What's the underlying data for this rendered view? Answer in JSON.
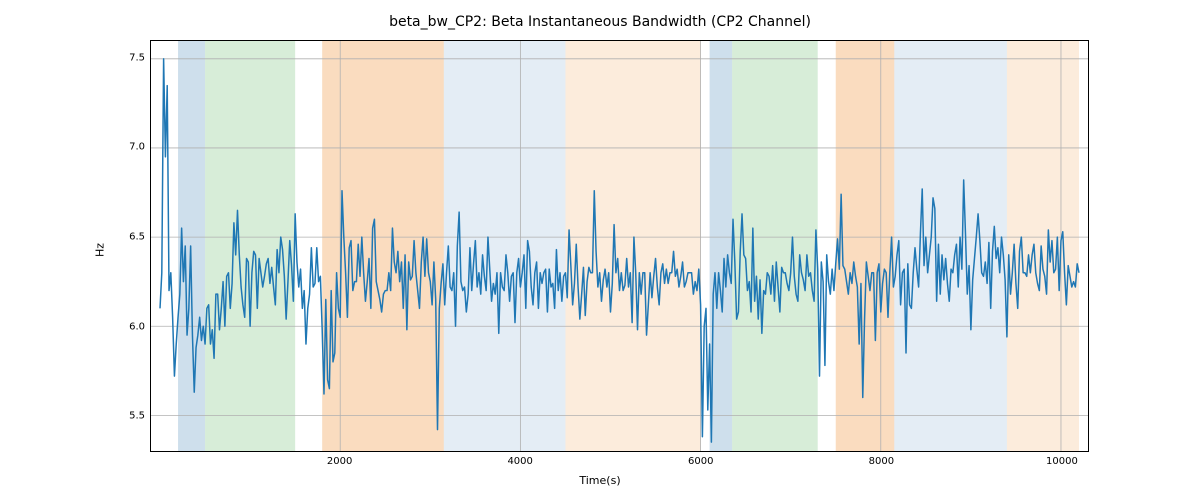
{
  "chart_data": {
    "type": "line",
    "title": "beta_bw_CP2: Beta Instantaneous Bandwidth (CP2 Channel)",
    "xlabel": "Time(s)",
    "ylabel": "Hz",
    "xlim": [
      -100,
      10300
    ],
    "ylim": [
      5.3,
      7.6
    ],
    "xticks": [
      2000,
      4000,
      6000,
      8000,
      10000
    ],
    "yticks": [
      5.5,
      6.0,
      6.5,
      7.0,
      7.5
    ],
    "regions": [
      {
        "x0": 200,
        "x1": 500,
        "color": "#a6c4dd",
        "alpha": 0.55
      },
      {
        "x0": 500,
        "x1": 1500,
        "color": "#b7dfb8",
        "alpha": 0.55
      },
      {
        "x0": 1800,
        "x1": 3150,
        "color": "#f6c08b",
        "alpha": 0.55
      },
      {
        "x0": 3150,
        "x1": 4500,
        "color": "#a6c4dd",
        "alpha": 0.3
      },
      {
        "x0": 4500,
        "x1": 6000,
        "color": "#f6c08b",
        "alpha": 0.3
      },
      {
        "x0": 6100,
        "x1": 6350,
        "color": "#a6c4dd",
        "alpha": 0.55
      },
      {
        "x0": 6350,
        "x1": 7300,
        "color": "#b7dfb8",
        "alpha": 0.55
      },
      {
        "x0": 7500,
        "x1": 8150,
        "color": "#f6c08b",
        "alpha": 0.55
      },
      {
        "x0": 8150,
        "x1": 9400,
        "color": "#a6c4dd",
        "alpha": 0.3
      },
      {
        "x0": 9400,
        "x1": 10200,
        "color": "#f6c08b",
        "alpha": 0.3
      }
    ],
    "line_color": "#1f77b4",
    "series": {
      "x": [
        0,
        20,
        40,
        60,
        80,
        100,
        120,
        140,
        160,
        180,
        200,
        220,
        240,
        260,
        280,
        300,
        320,
        340,
        360,
        380,
        400,
        420,
        440,
        460,
        480,
        500,
        520,
        540,
        560,
        580,
        600,
        620,
        640,
        660,
        680,
        700,
        720,
        740,
        760,
        780,
        800,
        820,
        840,
        860,
        880,
        900,
        920,
        940,
        960,
        980,
        1000,
        1020,
        1040,
        1060,
        1080,
        1100,
        1120,
        1140,
        1160,
        1180,
        1200,
        1220,
        1240,
        1260,
        1280,
        1300,
        1320,
        1340,
        1360,
        1380,
        1400,
        1420,
        1440,
        1460,
        1480,
        1500,
        1520,
        1540,
        1560,
        1580,
        1600,
        1620,
        1640,
        1660,
        1680,
        1700,
        1720,
        1740,
        1760,
        1780,
        1800,
        1820,
        1840,
        1860,
        1880,
        1900,
        1920,
        1940,
        1960,
        1980,
        2000,
        2020,
        2040,
        2060,
        2080,
        2100,
        2120,
        2140,
        2160,
        2180,
        2200,
        2220,
        2240,
        2260,
        2280,
        2300,
        2320,
        2340,
        2360,
        2380,
        2400,
        2420,
        2440,
        2460,
        2480,
        2500,
        2520,
        2540,
        2560,
        2580,
        2600,
        2620,
        2640,
        2660,
        2680,
        2700,
        2720,
        2740,
        2760,
        2780,
        2800,
        2820,
        2840,
        2860,
        2880,
        2900,
        2920,
        2940,
        2960,
        2980,
        3000,
        3020,
        3040,
        3060,
        3080,
        3100,
        3120,
        3140,
        3160,
        3180,
        3200,
        3220,
        3240,
        3260,
        3280,
        3300,
        3320,
        3340,
        3360,
        3380,
        3400,
        3420,
        3440,
        3460,
        3480,
        3500,
        3520,
        3540,
        3560,
        3580,
        3600,
        3620,
        3640,
        3660,
        3680,
        3700,
        3720,
        3740,
        3760,
        3780,
        3800,
        3820,
        3840,
        3860,
        3880,
        3900,
        3920,
        3940,
        3960,
        3980,
        4000,
        4020,
        4040,
        4060,
        4080,
        4100,
        4120,
        4140,
        4160,
        4180,
        4200,
        4220,
        4240,
        4260,
        4280,
        4300,
        4320,
        4340,
        4360,
        4380,
        4400,
        4420,
        4440,
        4460,
        4480,
        4500,
        4520,
        4540,
        4560,
        4580,
        4600,
        4620,
        4640,
        4660,
        4680,
        4700,
        4720,
        4740,
        4760,
        4780,
        4800,
        4820,
        4840,
        4860,
        4880,
        4900,
        4920,
        4940,
        4960,
        4980,
        5000,
        5020,
        5040,
        5060,
        5080,
        5100,
        5120,
        5140,
        5160,
        5180,
        5200,
        5220,
        5240,
        5260,
        5280,
        5300,
        5320,
        5340,
        5360,
        5380,
        5400,
        5420,
        5440,
        5460,
        5480,
        5500,
        5520,
        5540,
        5560,
        5580,
        5600,
        5620,
        5640,
        5660,
        5680,
        5700,
        5720,
        5740,
        5760,
        5780,
        5800,
        5820,
        5840,
        5860,
        5880,
        5900,
        5920,
        5940,
        5960,
        5980,
        6000,
        6020,
        6040,
        6060,
        6080,
        6100,
        6120,
        6140,
        6160,
        6180,
        6200,
        6220,
        6240,
        6260,
        6280,
        6300,
        6320,
        6340,
        6360,
        6380,
        6400,
        6420,
        6440,
        6460,
        6480,
        6500,
        6520,
        6540,
        6560,
        6580,
        6600,
        6620,
        6640,
        6660,
        6680,
        6700,
        6720,
        6740,
        6760,
        6780,
        6800,
        6820,
        6840,
        6860,
        6880,
        6900,
        6920,
        6940,
        6960,
        6980,
        7000,
        7020,
        7040,
        7060,
        7080,
        7100,
        7120,
        7140,
        7160,
        7180,
        7200,
        7220,
        7240,
        7260,
        7280,
        7300,
        7320,
        7340,
        7360,
        7380,
        7400,
        7420,
        7440,
        7460,
        7480,
        7500,
        7520,
        7540,
        7560,
        7580,
        7600,
        7620,
        7640,
        7660,
        7680,
        7700,
        7720,
        7740,
        7760,
        7780,
        7800,
        7820,
        7840,
        7860,
        7880,
        7900,
        7920,
        7940,
        7960,
        7980,
        8000,
        8020,
        8040,
        8060,
        8080,
        8100,
        8120,
        8140,
        8160,
        8180,
        8200,
        8220,
        8240,
        8260,
        8280,
        8300,
        8320,
        8340,
        8360,
        8380,
        8400,
        8420,
        8440,
        8460,
        8480,
        8500,
        8520,
        8540,
        8560,
        8580,
        8600,
        8620,
        8640,
        8660,
        8680,
        8700,
        8720,
        8740,
        8760,
        8780,
        8800,
        8820,
        8840,
        8860,
        8880,
        8900,
        8920,
        8940,
        8960,
        8980,
        9000,
        9020,
        9040,
        9060,
        9080,
        9100,
        9120,
        9140,
        9160,
        9180,
        9200,
        9220,
        9240,
        9260,
        9280,
        9300,
        9320,
        9340,
        9360,
        9380,
        9400,
        9420,
        9440,
        9460,
        9480,
        9500,
        9520,
        9540,
        9560,
        9580,
        9600,
        9620,
        9640,
        9660,
        9680,
        9700,
        9720,
        9740,
        9760,
        9780,
        9800,
        9820,
        9840,
        9860,
        9880,
        9900,
        9920,
        9940,
        9960,
        9980,
        10000,
        10020,
        10040,
        10060,
        10080,
        10100,
        10120,
        10140,
        10160,
        10180,
        10200
      ],
      "y": [
        6.1,
        6.3,
        7.5,
        6.95,
        7.35,
        6.2,
        6.3,
        6.05,
        5.72,
        5.9,
        6.05,
        6.18,
        6.55,
        6.25,
        6.45,
        5.95,
        6.1,
        6.45,
        5.95,
        5.63,
        5.88,
        5.95,
        6.05,
        5.92,
        6.0,
        5.9,
        6.1,
        6.12,
        5.9,
        5.98,
        5.82,
        6.18,
        6.18,
        5.98,
        6.1,
        6.25,
        6.0,
        6.28,
        6.3,
        6.1,
        6.24,
        6.58,
        6.4,
        6.65,
        6.4,
        6.22,
        6.12,
        6.05,
        6.38,
        6.36,
        6.0,
        6.3,
        6.42,
        6.4,
        6.1,
        6.38,
        6.3,
        6.22,
        6.28,
        6.35,
        6.38,
        6.24,
        6.33,
        6.22,
        6.12,
        6.43,
        6.3,
        6.5,
        6.43,
        6.28,
        6.04,
        6.25,
        6.48,
        6.34,
        6.14,
        6.63,
        6.36,
        6.22,
        6.32,
        6.1,
        6.2,
        5.9,
        6.1,
        6.18,
        6.44,
        6.22,
        6.24,
        6.44,
        6.25,
        6.28,
        5.98,
        5.62,
        6.15,
        5.7,
        5.65,
        6.2,
        5.8,
        5.85,
        6.3,
        6.1,
        6.05,
        6.76,
        6.5,
        6.3,
        6.05,
        6.44,
        6.48,
        6.2,
        6.25,
        6.25,
        6.46,
        6.28,
        6.5,
        6.3,
        6.14,
        6.25,
        6.38,
        6.1,
        6.55,
        6.6,
        6.25,
        6.2,
        6.15,
        6.08,
        6.18,
        6.2,
        6.2,
        6.3,
        6.2,
        6.55,
        6.36,
        6.3,
        6.42,
        6.25,
        6.36,
        6.1,
        6.4,
        5.98,
        6.36,
        6.26,
        6.28,
        6.48,
        6.3,
        6.2,
        6.1,
        6.36,
        6.5,
        6.28,
        6.49,
        6.3,
        6.25,
        6.12,
        6.36,
        6.15,
        5.42,
        6.1,
        6.24,
        6.35,
        6.12,
        6.3,
        6.45,
        6.22,
        6.2,
        6.3,
        6.0,
        6.45,
        6.64,
        6.25,
        6.2,
        6.22,
        6.08,
        6.18,
        6.44,
        6.2,
        6.35,
        6.48,
        6.22,
        6.3,
        6.18,
        6.4,
        6.28,
        6.2,
        6.5,
        6.32,
        6.14,
        6.24,
        6.18,
        6.3,
        5.96,
        6.3,
        6.22,
        6.2,
        6.4,
        6.3,
        6.14,
        6.28,
        6.3,
        6.02,
        6.3,
        6.38,
        6.22,
        6.3,
        6.4,
        6.1,
        6.48,
        6.42,
        6.22,
        6.12,
        6.3,
        6.36,
        6.1,
        6.3,
        6.24,
        6.3,
        6.32,
        6.08,
        6.32,
        6.22,
        6.24,
        6.1,
        6.43,
        6.2,
        6.3,
        6.14,
        6.28,
        6.3,
        6.16,
        6.54,
        6.34,
        6.12,
        6.24,
        6.46,
        6.22,
        6.04,
        6.18,
        6.33,
        6.06,
        6.25,
        6.33,
        6.3,
        6.3,
        6.76,
        6.42,
        6.22,
        6.3,
        6.14,
        6.26,
        6.32,
        6.22,
        6.3,
        6.08,
        6.24,
        6.57,
        6.3,
        6.38,
        6.2,
        6.3,
        6.2,
        6.23,
        6.38,
        6.22,
        6.3,
        6.02,
        6.5,
        6.3,
        5.98,
        6.3,
        6.18,
        6.3,
        6.3,
        5.95,
        6.12,
        6.3,
        6.16,
        6.28,
        6.38,
        6.22,
        6.12,
        6.3,
        6.35,
        6.24,
        6.32,
        6.24,
        6.3,
        6.3,
        6.42,
        6.28,
        6.32,
        6.22,
        6.28,
        6.36,
        6.22,
        6.25,
        6.3,
        6.3,
        6.3,
        6.18,
        6.25,
        6.2,
        6.32,
        6.12,
        5.38,
        6.0,
        6.1,
        5.53,
        5.9,
        5.35,
        6.18,
        6.3,
        6.1,
        6.3,
        6.2,
        6.08,
        6.38,
        6.22,
        6.4,
        6.3,
        6.24,
        6.6,
        6.36,
        6.04,
        6.08,
        6.42,
        6.63,
        6.4,
        6.38,
        6.2,
        6.25,
        6.08,
        6.55,
        6.14,
        6.28,
        6.04,
        6.26,
        5.96,
        6.2,
        6.18,
        6.3,
        6.28,
        6.18,
        6.34,
        6.14,
        6.36,
        6.22,
        6.08,
        6.33,
        6.3,
        6.3,
        6.24,
        6.2,
        6.3,
        6.5,
        6.28,
        6.18,
        6.14,
        6.4,
        6.3,
        6.26,
        6.2,
        6.4,
        6.28,
        6.3,
        6.2,
        6.14,
        6.54,
        6.32,
        5.72,
        6.36,
        6.25,
        5.78,
        6.4,
        6.25,
        6.18,
        6.32,
        6.2,
        6.35,
        6.49,
        6.32,
        6.74,
        6.34,
        6.32,
        6.25,
        6.18,
        6.3,
        6.24,
        6.36,
        6.28,
        6.22,
        5.9,
        6.24,
        5.6,
        6.04,
        6.36,
        6.28,
        6.2,
        6.3,
        6.3,
        5.92,
        6.3,
        6.35,
        6.08,
        6.24,
        6.32,
        6.3,
        6.05,
        6.3,
        6.5,
        6.22,
        6.28,
        6.4,
        6.48,
        6.12,
        6.3,
        6.32,
        5.85,
        6.35,
        6.12,
        6.1,
        6.3,
        6.44,
        6.32,
        6.22,
        6.52,
        6.77,
        6.34,
        6.5,
        6.3,
        6.4,
        6.5,
        6.72,
        6.66,
        6.14,
        6.46,
        6.18,
        6.4,
        6.26,
        6.38,
        6.24,
        6.14,
        6.32,
        6.3,
        6.4,
        6.46,
        6.22,
        6.5,
        6.32,
        6.82,
        6.52,
        6.18,
        6.34,
        5.98,
        6.26,
        6.38,
        6.5,
        6.63,
        6.48,
        6.3,
        6.28,
        6.36,
        6.24,
        6.47,
        6.1,
        6.42,
        6.56,
        6.38,
        6.44,
        6.3,
        6.5,
        6.4,
        6.26,
        5.94,
        6.4,
        6.18,
        6.3,
        6.46,
        6.24,
        6.1,
        6.42,
        6.5,
        6.3,
        6.3,
        6.28,
        6.4,
        6.3,
        6.4,
        6.46,
        6.3,
        6.24,
        6.2,
        6.45,
        6.32,
        6.28,
        6.18,
        6.54,
        6.36,
        6.48,
        6.3,
        6.32,
        6.5,
        6.2,
        6.48,
        6.53,
        6.3,
        6.12,
        6.34,
        6.28,
        6.22,
        6.25,
        6.22,
        6.35,
        6.3
      ]
    }
  }
}
